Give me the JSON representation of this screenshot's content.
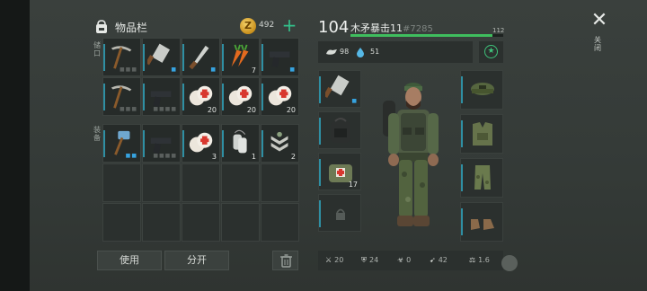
{
  "inventory": {
    "title": "物品栏",
    "coins": "492",
    "add_symbol": "+",
    "side_label_top": "储口",
    "side_label_bottom": "装备",
    "rows": [
      [
        {
          "icon": "pickaxe-icon",
          "count": "",
          "dots": 3,
          "dots_on": 0
        },
        {
          "icon": "cleaver-icon",
          "count": "",
          "dots": 1,
          "dots_on": 1
        },
        {
          "icon": "knife-icon",
          "count": "",
          "dots": 1,
          "dots_on": 1
        },
        {
          "icon": "carrot-icon",
          "count": "7",
          "dots": 0,
          "dots_on": 0
        },
        {
          "icon": "pistol-icon",
          "count": "",
          "dots": 1,
          "dots_on": 1
        }
      ],
      [
        {
          "icon": "pickaxe-icon",
          "count": "",
          "dots": 3,
          "dots_on": 0
        },
        {
          "icon": "pistol-icon",
          "count": "",
          "dots": 4,
          "dots_on": 0
        },
        {
          "icon": "bandage-icon",
          "count": "20",
          "dots": 0,
          "dots_on": 0
        },
        {
          "icon": "bandage-icon",
          "count": "20",
          "dots": 0,
          "dots_on": 0
        },
        {
          "icon": "bandage-icon",
          "count": "20",
          "dots": 0,
          "dots_on": 0
        }
      ],
      [
        {
          "icon": "hammer-icon",
          "count": "",
          "dots": 2,
          "dots_on": 2
        },
        {
          "icon": "pistol-icon",
          "count": "",
          "dots": 4,
          "dots_on": 0
        },
        {
          "icon": "bandage-icon",
          "count": "3",
          "dots": 0,
          "dots_on": 0
        },
        {
          "icon": "dog-tag-icon",
          "count": "1",
          "dots": 0,
          "dots_on": 0
        },
        {
          "icon": "rank-badge-icon",
          "count": "2",
          "dots": 0,
          "dots_on": 0
        }
      ],
      [
        {
          "icon": "",
          "count": "",
          "dots": 0,
          "dots_on": 0
        },
        {
          "icon": "",
          "count": "",
          "dots": 0,
          "dots_on": 0
        },
        {
          "icon": "",
          "count": "",
          "dots": 0,
          "dots_on": 0
        },
        {
          "icon": "",
          "count": "",
          "dots": 0,
          "dots_on": 0
        },
        {
          "icon": "",
          "count": "",
          "dots": 0,
          "dots_on": 0
        }
      ],
      [
        {
          "icon": "",
          "count": "",
          "dots": 0,
          "dots_on": 0
        },
        {
          "icon": "",
          "count": "",
          "dots": 0,
          "dots_on": 0
        },
        {
          "icon": "",
          "count": "",
          "dots": 0,
          "dots_on": 0
        },
        {
          "icon": "",
          "count": "",
          "dots": 0,
          "dots_on": 0
        },
        {
          "icon": "",
          "count": "",
          "dots": 0,
          "dots_on": 0
        }
      ]
    ],
    "use_button": "使用",
    "split_button": "分开"
  },
  "character": {
    "level": "104",
    "name": "木矛暴击11",
    "id": "#7285",
    "xp_max": "112",
    "xp_fraction": 0.93,
    "food": "98",
    "water": "51",
    "equipment_left": [
      {
        "icon": "cleaver-icon",
        "count": "",
        "dots": 1,
        "dots_on": 1
      },
      {
        "icon": "backpack-icon",
        "count": "",
        "dots": 0,
        "dots_on": 0
      },
      {
        "icon": "medkit-bag-icon",
        "count": "17",
        "dots": 0,
        "dots_on": 0
      },
      {
        "icon": "lock-icon",
        "count": "",
        "dots": 0,
        "dots_on": 0
      }
    ],
    "equipment_right": [
      {
        "icon": "helmet-cap-icon"
      },
      {
        "icon": "vest-icon"
      },
      {
        "icon": "pants-icon"
      },
      {
        "icon": "boots-icon"
      }
    ],
    "bottom_stats": {
      "attack": "20",
      "defense": "24",
      "toxic": "0",
      "speed": "42",
      "weight": "1.6"
    }
  },
  "close_label": "关闭",
  "colors": {
    "accent_green": "#3fbe5e",
    "accent_teal": "#2f8fa3",
    "plus_green": "#33c08a"
  }
}
